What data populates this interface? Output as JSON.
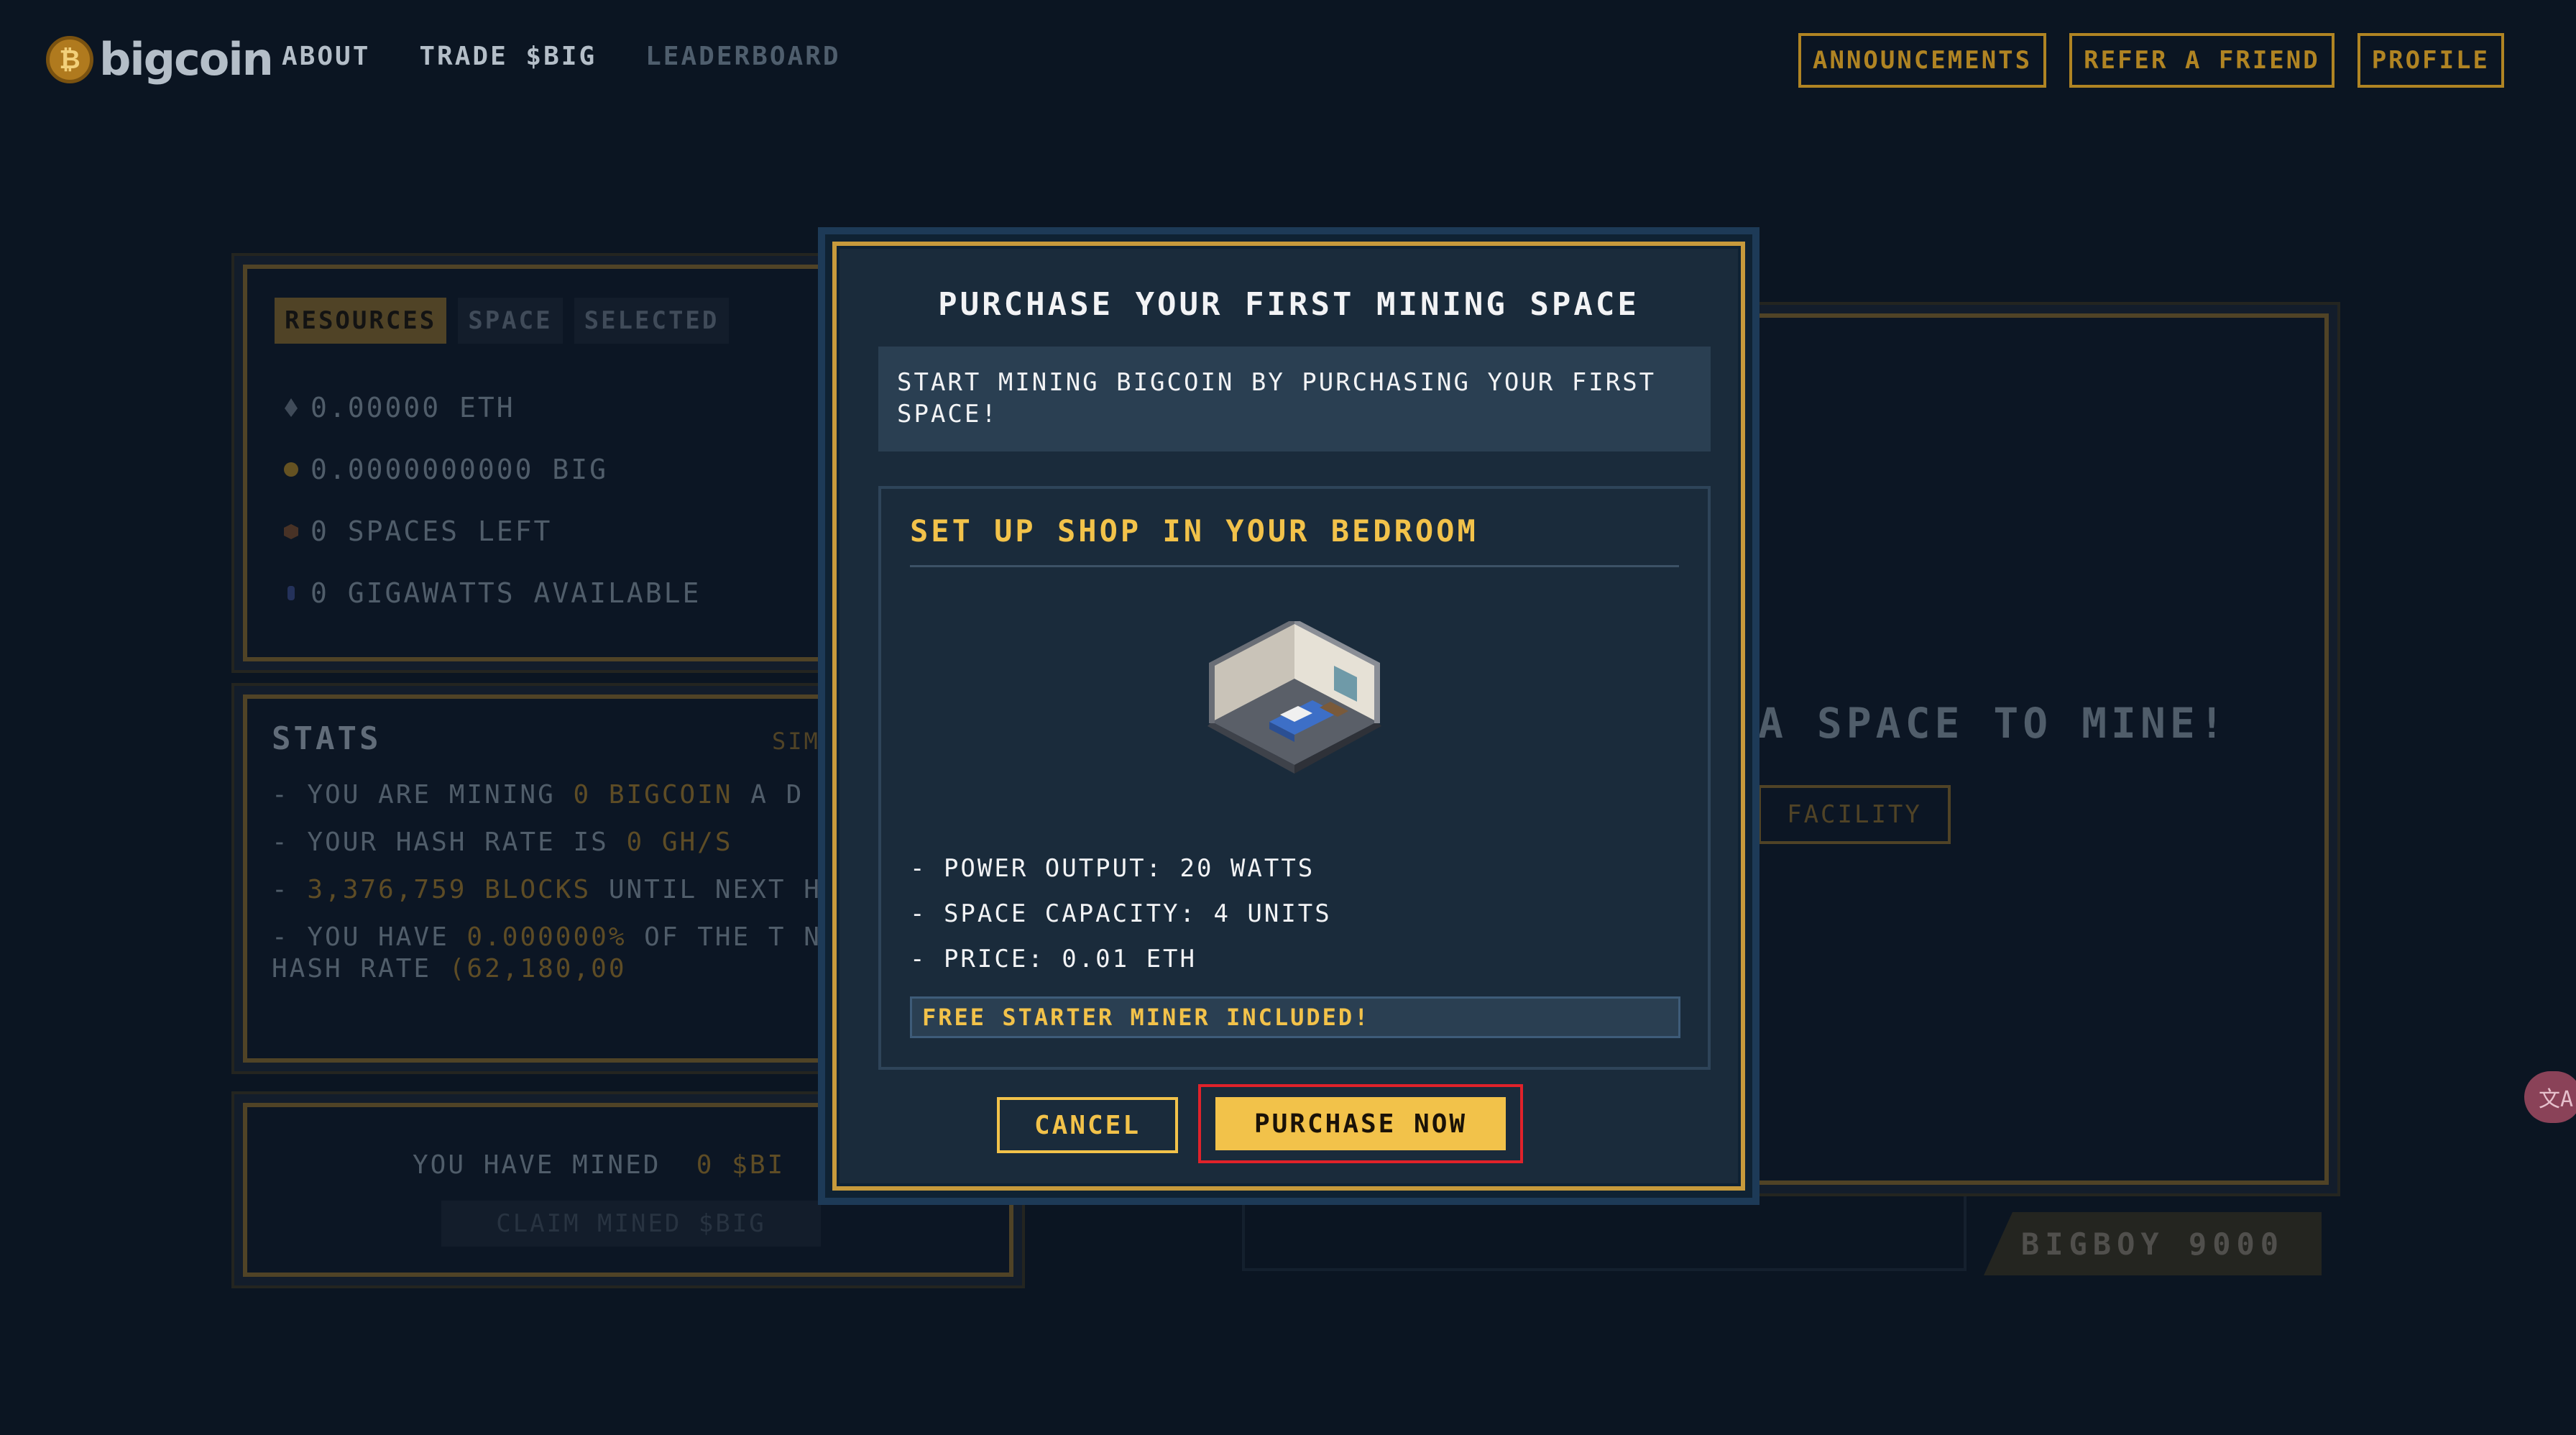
{
  "header": {
    "logo_text": "bigcoin",
    "nav": [
      "ABOUT",
      "TRADE $BIG",
      "LEADERBOARD"
    ],
    "buttons": [
      "ANNOUNCEMENTS",
      "REFER A FRIEND",
      "PROFILE"
    ]
  },
  "resources": {
    "tabs": [
      "RESOURCES",
      "SPACE",
      "SELECTED"
    ],
    "items": [
      {
        "icon": "eth-icon",
        "text": "0.00000 ETH"
      },
      {
        "icon": "big-coin-icon",
        "text": "0.0000000000 BIG"
      },
      {
        "icon": "space-icon",
        "text": "0 SPACES LEFT"
      },
      {
        "icon": "power-icon",
        "text": "0 GIGAWATTS AVAILABLE"
      }
    ]
  },
  "stats": {
    "title": "STATS",
    "sim_label": "SIM",
    "line1_prefix": "- YOU ARE MINING ",
    "line1_value": "0 BIGCOIN",
    "line1_suffix": " A D",
    "line2_prefix": "- YOUR HASH RATE IS ",
    "line2_value": "0 GH/S",
    "line3_prefix": "- ",
    "line3_value": "3,376,759 BLOCKS",
    "line3_suffix": " UNTIL NEXT HALVENING",
    "line4_prefix": "- YOU HAVE ",
    "line4_value": "0.000000%",
    "line4_suffix": " OF THE T NETWORK HASH RATE ",
    "line4_rate": "(62,180,00"
  },
  "mined": {
    "label": "YOU HAVE MINED",
    "value": "0 $BI",
    "claim_label": "CLAIM MINED $BIG"
  },
  "machine": {
    "prompt": "A SPACE TO MINE!",
    "button": "FACILITY",
    "name": "BIGBOY 9000"
  },
  "side_bubble": "文A",
  "modal": {
    "title": "PURCHASE YOUR FIRST MINING SPACE",
    "intro": "START MINING BIGCOIN BY PURCHASING YOUR FIRST SPACE!",
    "card_title": "SET UP SHOP IN YOUR BEDROOM",
    "specs": [
      "- POWER OUTPUT: 20 WATTS",
      "- SPACE CAPACITY: 4 UNITS",
      "- PRICE: 0.01 ETH"
    ],
    "free_banner": "FREE STARTER MINER INCLUDED!",
    "cancel_label": "CANCEL",
    "purchase_label": "PURCHASE NOW"
  },
  "colors": {
    "accent": "#f2c24a",
    "background": "#0b1522",
    "modal_bg": "#1a2b3b",
    "highlight_outline": "#e0222a"
  }
}
